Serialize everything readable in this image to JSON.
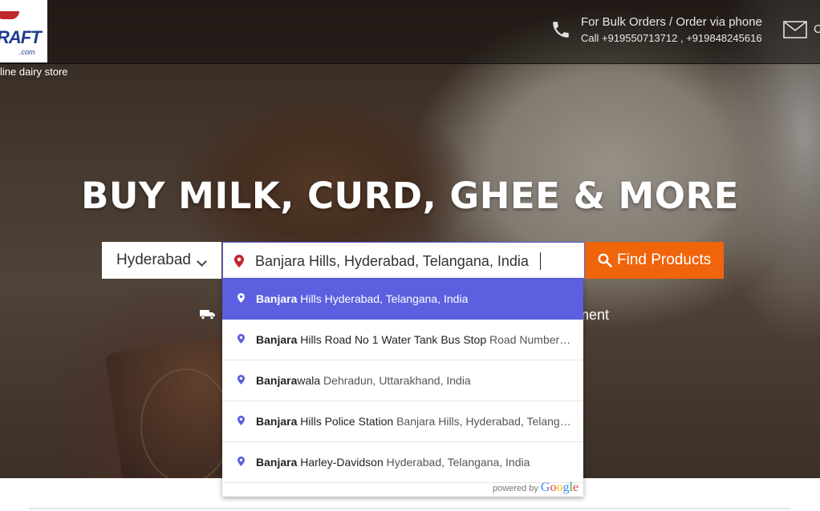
{
  "header": {
    "logo_word": "RAFT",
    "logo_com": ".com",
    "tagline": "line dairy store",
    "bulk_line1": "For Bulk Orders / Order via phone",
    "bulk_line2": "Call +919550713712 , +919848245616",
    "mail_extra": "C"
  },
  "hero": {
    "headline": "BUY MILK, CURD, GHEE & MORE",
    "feature_payment": "yment"
  },
  "search": {
    "city_selected": "Hyderabad",
    "location_value": "Banjara Hills, Hyderabad, Telangana, India",
    "find_button": "Find Products"
  },
  "suggestions": [
    {
      "match": "Banjara",
      "rest_main": " Hills",
      "secondary": " Hyderabad, Telangana, India",
      "active": true
    },
    {
      "match": "Banjara",
      "rest_main": " Hills Road No 1 Water Tank Bus Stop",
      "secondary": " Road Number 1…",
      "active": false
    },
    {
      "match": "Banjara",
      "rest_main": "wala",
      "secondary": " Dehradun, Uttarakhand, India",
      "active": false
    },
    {
      "match": "Banjara",
      "rest_main": " Hills Police Station",
      "secondary": " Banjara Hills, Hyderabad, Telanga…",
      "active": false
    },
    {
      "match": "Banjara",
      "rest_main": " Harley-Davidson",
      "secondary": " Hyderabad, Telangana, India",
      "active": false
    }
  ],
  "powered_by": "powered by",
  "colors": {
    "accent": "#5b5fe0",
    "find_button": "#f0640b",
    "pin": "#c0262d"
  }
}
